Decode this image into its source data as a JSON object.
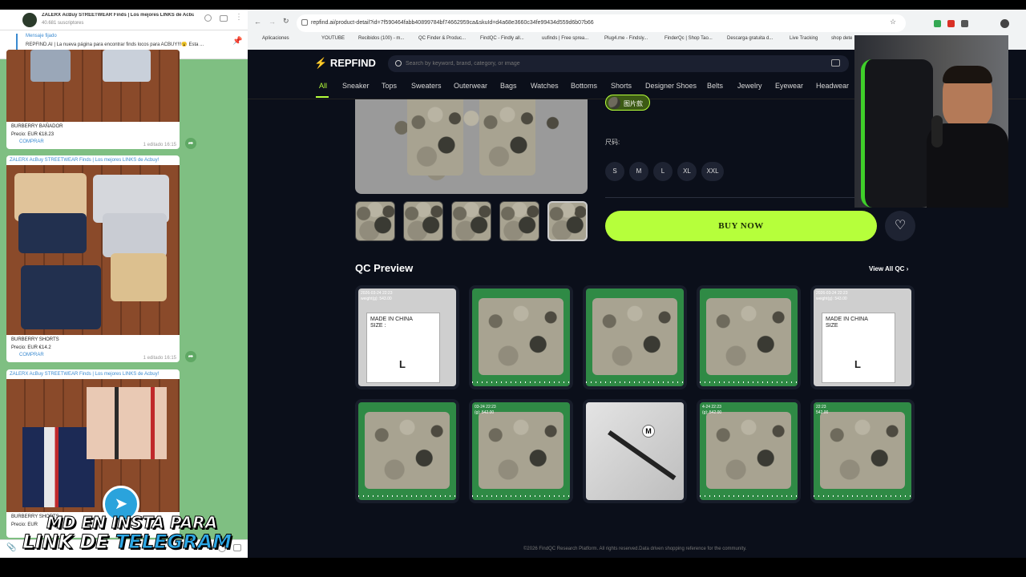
{
  "telegram": {
    "channel_title": "ZALERX AcBuy STREETWEAR Finds | Los mejores LINKS de Acbuy!",
    "subscribers": "40.681 suscriptores",
    "pinned_label": "Mensaje fijado",
    "pinned_text": "REPFIND.AI | La nueva página para encontrar finds locos para ACBUY!!!😮 Esta ...",
    "messages": [
      {
        "caption": "BURBERRY BAÑADOR",
        "price": "Precio: EUR €18.23",
        "link": "COMPRAR",
        "meta": "1 editado 16:15"
      },
      {
        "header": "ZALERX AcBuy STREETWEAR Finds | Los mejores LINKS de Acbuy!",
        "caption": "BURBERRY SHORTS",
        "price": "Precio: EUR €14.2",
        "link": "COMPRAR",
        "meta": "1 editado 16:15"
      },
      {
        "header": "ZALERX AcBuy STREETWEAR Finds | Los mejores LINKS de Acbuy!",
        "caption": "BURBERRY SHORTS",
        "price": "Precio: EUR"
      }
    ]
  },
  "browser": {
    "url": "repfind.ai/product-detail?id=7f590464fabb40899784bf74662959ca&skuId=d4a68e3660c34fe99434d559d6b07b66",
    "bookmarks": [
      "Aplicaciones",
      "YOUTUBE",
      "Recibidos (100) - m...",
      "QC Finder & Produc...",
      "FindQC - Findly all...",
      "uufinds | Free sprea...",
      "Plug4.me - Findsly...",
      "FinderQc | Shop Tao...",
      "Descarga gratuita d...",
      "Live Tracking",
      "shop dete"
    ]
  },
  "site": {
    "brand": "REPFIND",
    "search_placeholder": "Search by keyword, brand, category, or image",
    "categories": [
      "All",
      "Sneaker",
      "Tops",
      "Sweaters",
      "Outerwear",
      "Bags",
      "Watches",
      "Bottoms",
      "Shorts",
      "Designer Shoes",
      "Belts",
      "Jewelry",
      "Eyewear",
      "Headwear"
    ],
    "variant_label": "图片款",
    "size_label": "尺码:",
    "sizes": [
      "S",
      "M",
      "L",
      "XL",
      "XXL"
    ],
    "buy_now": "BUY NOW",
    "qc_title": "QC Preview",
    "view_all": "View All QC",
    "footer": "©2026 FindQC Research Platform. All rights reserved.Data driven shopping reference for the community.",
    "qc_items": [
      {
        "stamp": "2026-03-24 22:23\nweight(g): 543.00",
        "kind": "tag",
        "tag_text": "MADE IN CHINA\nSIZE :",
        "size": "L"
      },
      {
        "stamp": "",
        "kind": "camo-green"
      },
      {
        "stamp": "",
        "kind": "camo-green"
      },
      {
        "stamp": "",
        "kind": "camo-green"
      },
      {
        "stamp": "2026-03-24 22:23\nweight(g): 543.00",
        "kind": "tag",
        "tag_text": "MADE IN CHINA\nSIZE",
        "size": "L"
      },
      {
        "stamp": "",
        "kind": "camo-green"
      },
      {
        "stamp": "03-24 22:23\n(g): 542.00",
        "kind": "camo-green"
      },
      {
        "stamp": "",
        "kind": "bag",
        "bag_text": "M"
      },
      {
        "stamp": "4-24 22:23\n(g): 542.00",
        "kind": "camo-green"
      },
      {
        "stamp": "22:23\n542.00",
        "kind": "camo-green"
      }
    ]
  },
  "overlay": {
    "line1": "MD EN INSTA PARA",
    "line2a": "LINK DE ",
    "line2b": "TELEGRAM"
  },
  "colors": {
    "accent": "#b6ff3b",
    "page_bg": "#0b0f1a",
    "telegram_bg": "#7fbf82",
    "telegram_blue": "#3a8ad0"
  }
}
